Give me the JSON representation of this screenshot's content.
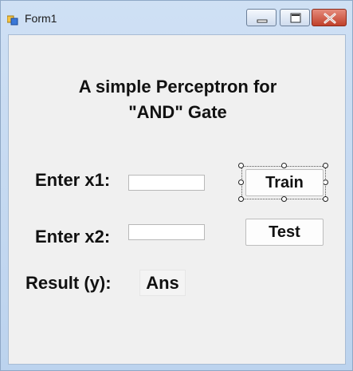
{
  "window": {
    "title": "Form1",
    "icons": {
      "app": "form-icon",
      "minimize": "minimize-icon",
      "maximize": "maximize-icon",
      "close": "close-icon"
    }
  },
  "form": {
    "heading_line1": "A simple Perceptron for",
    "heading_line2": "\"AND\" Gate",
    "x1_label": "Enter x1:",
    "x1_value": "",
    "x2_label": "Enter x2:",
    "x2_value": "",
    "result_label": "Result (y):",
    "result_value": "Ans",
    "train_label": "Train",
    "test_label": "Test"
  }
}
